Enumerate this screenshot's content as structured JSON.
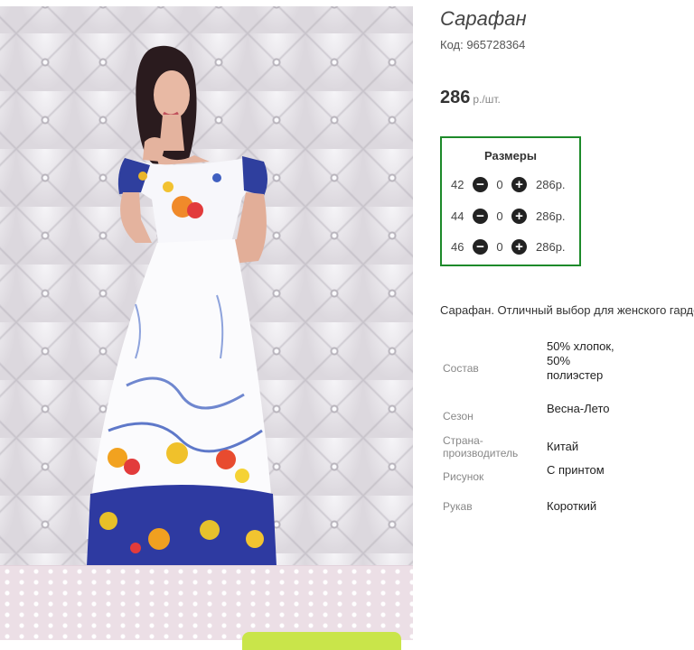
{
  "product": {
    "title": "Сарафан",
    "code": "Код: 965728364",
    "price": "286",
    "price_unit": "р./шт.",
    "description": "Сарафан. Отличный выбор для женского гардероба"
  },
  "sizes": {
    "heading": "Размеры",
    "rows": [
      {
        "size": "42",
        "qty": "0",
        "price": "286р."
      },
      {
        "size": "44",
        "qty": "0",
        "price": "286р."
      },
      {
        "size": "46",
        "qty": "0",
        "price": "286р."
      }
    ]
  },
  "properties": [
    {
      "label": "Состав",
      "value": "50% хлопок, 50% полиэстер"
    },
    {
      "label": "Сезон",
      "value": "Весна-Лето"
    },
    {
      "label": "Страна-производитель",
      "value": "Китай"
    },
    {
      "label": "Рисунок",
      "value": "С принтом"
    },
    {
      "label": "Рукав",
      "value": "Короткий"
    }
  ],
  "icons": {
    "minus": "minus-circle-icon",
    "plus": "plus-circle-icon"
  },
  "colors": {
    "accent_border": "#1d8a2a",
    "cart_button": "#c9e54a"
  }
}
